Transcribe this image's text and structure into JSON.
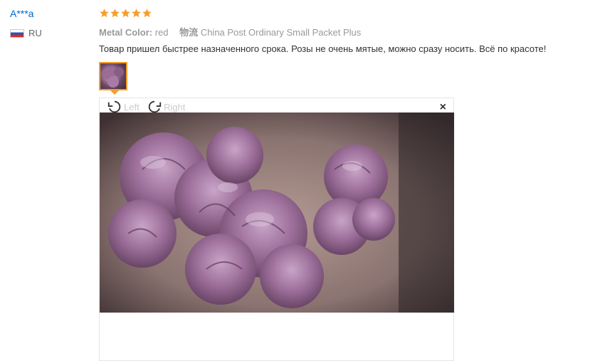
{
  "review": {
    "user_name": "A***a",
    "country_code": "RU",
    "rating_stars": 5,
    "attributes": [
      {
        "key": "Metal Color:",
        "value": "red"
      },
      {
        "key": "物流",
        "value": "China Post Ordinary Small Packet Plus"
      }
    ],
    "text": "Товар пришел быстрее назначенного срока. Розы не очень мятые, можно сразу носить. Всё по красоте!"
  },
  "viewer": {
    "rotate_left_label": "Left",
    "rotate_right_label": "Right",
    "close_label": "×"
  },
  "colors": {
    "link_blue": "#0066cc",
    "star_orange": "#f59e2a",
    "attr_gray": "#999999"
  }
}
